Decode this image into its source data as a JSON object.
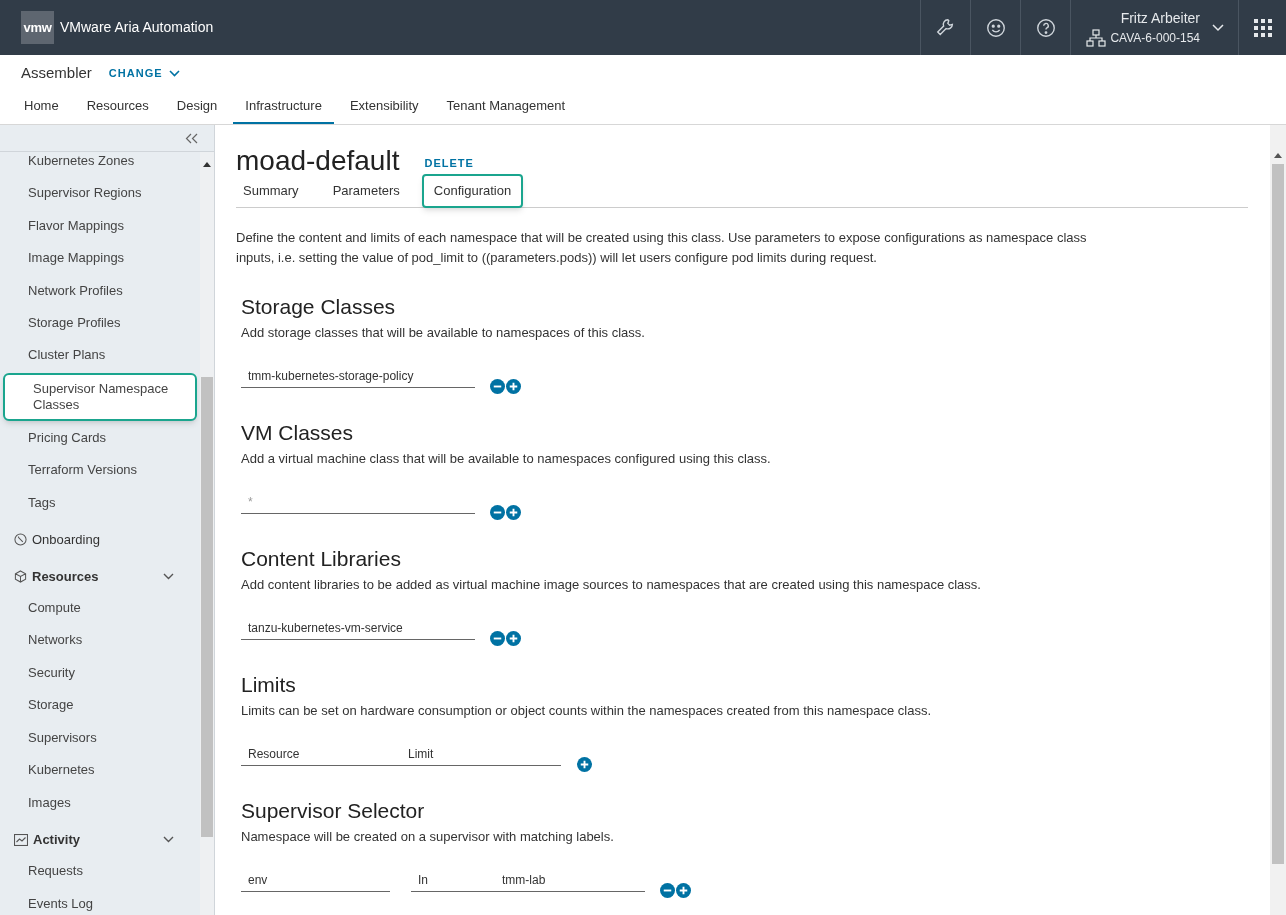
{
  "header": {
    "logo": "vmw",
    "product": "VMware Aria Automation",
    "user": "Fritz Arbeiter",
    "org": "CAVA-6-000-154"
  },
  "subheader": {
    "service": "Assembler",
    "change": "CHANGE"
  },
  "nav_tabs": [
    {
      "label": "Home",
      "selected": false
    },
    {
      "label": "Resources",
      "selected": false
    },
    {
      "label": "Design",
      "selected": false
    },
    {
      "label": "Infrastructure",
      "selected": true
    },
    {
      "label": "Extensibility",
      "selected": false
    },
    {
      "label": "Tenant Management",
      "selected": false
    }
  ],
  "sidebar": {
    "items": [
      {
        "kind": "link",
        "label": "Kubernetes Zones",
        "selected": false
      },
      {
        "kind": "link",
        "label": "Supervisor Regions",
        "selected": false
      },
      {
        "kind": "link",
        "label": "Flavor Mappings",
        "selected": false
      },
      {
        "kind": "link",
        "label": "Image Mappings",
        "selected": false
      },
      {
        "kind": "link",
        "label": "Network Profiles",
        "selected": false
      },
      {
        "kind": "link",
        "label": "Storage Profiles",
        "selected": false
      },
      {
        "kind": "link",
        "label": "Cluster Plans",
        "selected": false
      },
      {
        "kind": "link",
        "label": "Supervisor Namespace Classes",
        "selected": true
      },
      {
        "kind": "link",
        "label": "Pricing Cards",
        "selected": false
      },
      {
        "kind": "link",
        "label": "Terraform Versions",
        "selected": false
      },
      {
        "kind": "link",
        "label": "Tags",
        "selected": false
      },
      {
        "kind": "section",
        "label": "Onboarding",
        "expanded": false
      },
      {
        "kind": "section",
        "label": "Resources",
        "expanded": true
      },
      {
        "kind": "link",
        "label": "Compute",
        "selected": false
      },
      {
        "kind": "link",
        "label": "Networks",
        "selected": false
      },
      {
        "kind": "link",
        "label": "Security",
        "selected": false
      },
      {
        "kind": "link",
        "label": "Storage",
        "selected": false
      },
      {
        "kind": "link",
        "label": "Supervisors",
        "selected": false
      },
      {
        "kind": "link",
        "label": "Kubernetes",
        "selected": false
      },
      {
        "kind": "link",
        "label": "Images",
        "selected": false
      },
      {
        "kind": "section",
        "label": "Activity",
        "expanded": true
      },
      {
        "kind": "link",
        "label": "Requests",
        "selected": false
      },
      {
        "kind": "link",
        "label": "Events Log",
        "selected": false
      }
    ]
  },
  "page": {
    "title": "moad-default",
    "delete": "DELETE",
    "tabs": [
      {
        "label": "Summary",
        "selected": false
      },
      {
        "label": "Parameters",
        "selected": false
      },
      {
        "label": "Configuration",
        "selected": true
      }
    ],
    "intro": "Define the content and limits of each namespace that will be created using this class. Use parameters to expose configurations as namespace class inputs, i.e. setting the value of pod_limit to ((parameters.pods)) will let users configure pod limits during request.",
    "sections": [
      {
        "title": "Storage Classes",
        "description": "Add storage classes that will be available to namespaces of this class.",
        "fields": [
          {
            "kind": "wide",
            "value": "tmm-kubernetes-storage-policy"
          }
        ],
        "removable": true
      },
      {
        "title": "VM Classes",
        "description": "Add a virtual machine class that will be available to namespaces configured using this class.",
        "fields": [
          {
            "kind": "wide",
            "placeholder": "*"
          }
        ],
        "removable": true
      },
      {
        "title": "Content Libraries",
        "description": "Add content libraries to be added as virtual machine image sources to namespaces that are created using this namespace class.",
        "fields": [
          {
            "kind": "wide",
            "value": "tanzu-kubernetes-vm-service"
          }
        ],
        "removable": true
      },
      {
        "title": "Limits",
        "description": "Limits can be set on hardware consumption or object counts within the namespaces created from this namespace class.",
        "fields": [
          {
            "kind": "pair",
            "placeholder": "Resource"
          },
          {
            "kind": "limit",
            "placeholder": "Limit"
          }
        ],
        "removable": false
      },
      {
        "title": "Supervisor Selector",
        "description": "Namespace will be created on a supervisor with matching labels.",
        "fields": [
          {
            "kind": "key",
            "value": "env"
          },
          {
            "kind": "operator",
            "value": "In"
          },
          {
            "kind": "values",
            "value": "tmm-lab"
          }
        ],
        "removable": true
      }
    ]
  }
}
